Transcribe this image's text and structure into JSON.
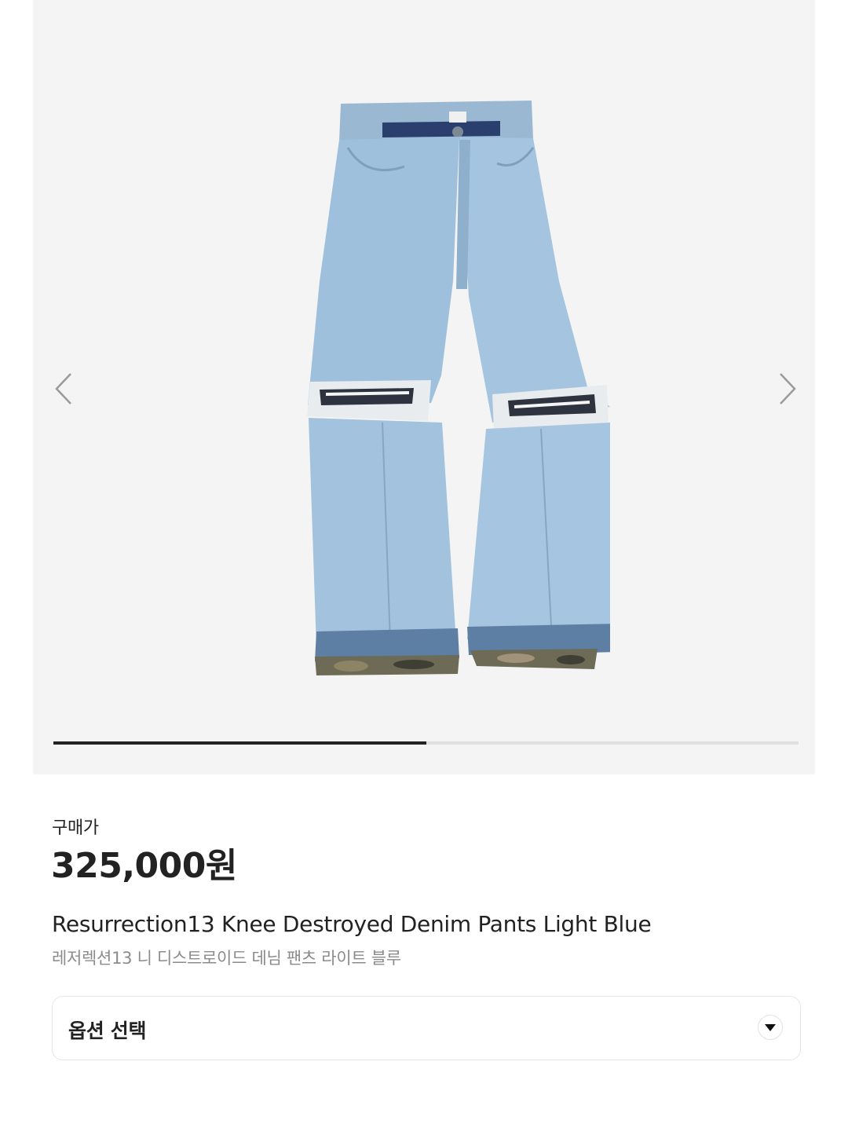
{
  "gallery": {
    "image_alt": "Resurrection13 Knee Destroyed Denim Pants Light Blue",
    "prev_icon": "chevron-left-icon",
    "next_icon": "chevron-right-icon",
    "progress": 0.5
  },
  "price": {
    "label": "구매가",
    "value": "325,000원"
  },
  "product": {
    "title": "Resurrection13 Knee Destroyed Denim Pants Light Blue",
    "subtitle": "레저렉션13 니 디스트로이드 데님 팬츠 라이트 블루"
  },
  "option": {
    "label": "옵션 선택",
    "icon": "caret-down-icon"
  }
}
